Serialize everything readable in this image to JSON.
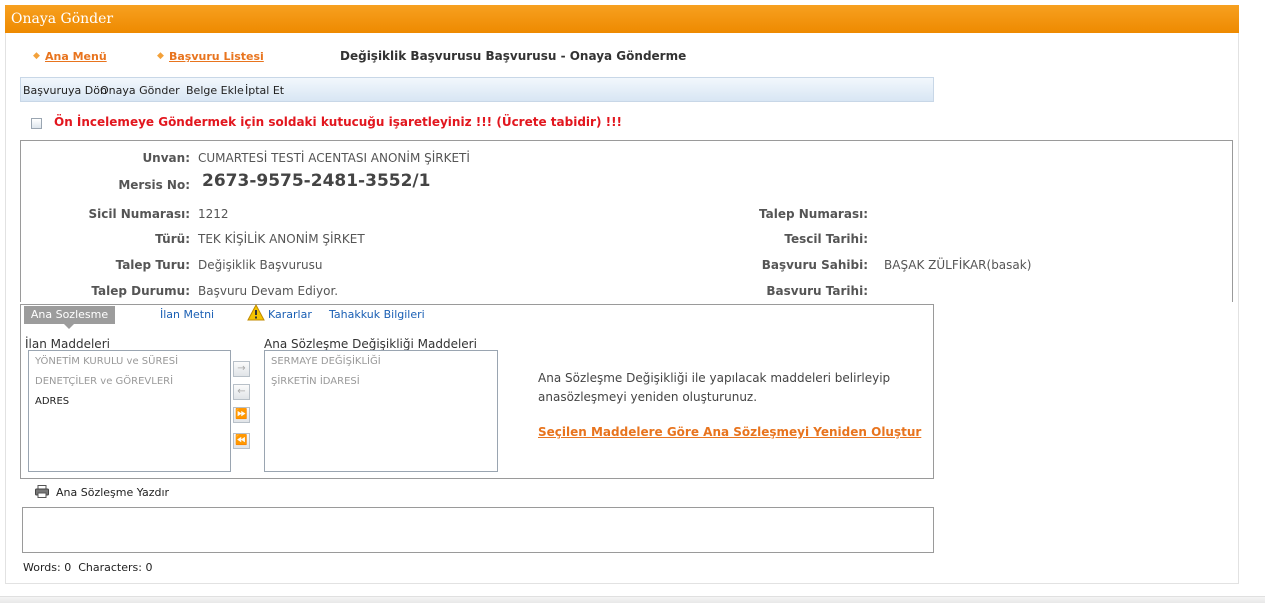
{
  "window": {
    "title": "Onaya Gönder"
  },
  "nav": {
    "main_menu": "Ana Menü",
    "application_list": "Başvuru Listesi",
    "page_title": "Değişiklik Başvurusu Başvurusu - Onaya Gönderme"
  },
  "toolbar": {
    "back": "Başvuruya Dön",
    "send_approval": "Onaya Gönder",
    "add_document": "Belge Ekle",
    "cancel": "İptal Et"
  },
  "warning": {
    "text": "Ön İncelemeye Göndermek için soldaki kutucuğu işaretleyiniz !!! (Ücrete tabidir) !!!"
  },
  "info": {
    "title_label": "Unvan:",
    "title_value": "CUMARTESİ TESTİ ACENTASI ANONİM ŞİRKETİ",
    "mersis_label": "Mersis No:",
    "mersis_value": "2673-9575-2481-3552/1",
    "registry_label": "Sicil Numarası:",
    "registry_value": "1212",
    "type_label": "Türü:",
    "type_value": "TEK KİŞİLİK ANONİM ŞİRKET",
    "request_type_label": "Talep Turu:",
    "request_type_value": "Değişiklik Başvurusu",
    "request_status_label": "Talep Durumu:",
    "request_status_value": "Başvuru Devam Ediyor.",
    "request_no_label": "Talep Numarası:",
    "registration_date_label": "Tescil Tarihi:",
    "applicant_label": "Başvuru Sahibi:",
    "applicant_value": "BAŞAK ZÜLFİKAR(basak)",
    "application_date_label": "Basvuru Tarihi:"
  },
  "tabs": {
    "articles": "Ana Sozlesme",
    "announcement": "İlan Metni",
    "decisions": "Kararlar",
    "accrual": "Tahakkuk Bilgileri"
  },
  "lists": {
    "left_label": "İlan Maddeleri",
    "left_items": [
      {
        "text": "YÖNETİM KURULU ve SÜRESİ",
        "state": "disabled"
      },
      {
        "text": "DENETÇİLER ve GÖREVLERİ",
        "state": "disabled"
      },
      {
        "text": "ADRES",
        "state": "enabled"
      }
    ],
    "right_label": "Ana Sözleşme Değişikliği Maddeleri",
    "right_items": [
      {
        "text": "SERMAYE DEĞİŞİKLİĞİ",
        "state": "disabled"
      },
      {
        "text": "ŞİRKETİN İDARESİ",
        "state": "disabled"
      }
    ],
    "move_buttons": {
      "add_one": "→",
      "remove_one": "←",
      "add_all": "⏩",
      "remove_all": "⏪"
    }
  },
  "hint": {
    "text": "Ana Sözleşme Değişikliği ile yapılacak maddeleri belirleyip anasözleşmeyi yeniden oluşturunuz.",
    "link": "Seçilen Maddelere Göre Ana Sözleşmeyi Yeniden Oluştur"
  },
  "print": {
    "label": "Ana Sözleşme Yazdır"
  },
  "editor": {
    "words_label": "Words:",
    "words": "0",
    "chars_label": "Characters:",
    "chars": "0"
  },
  "colors": {
    "header": "#ee8a00",
    "link": "#e8741e",
    "warning": "#e2161e",
    "tab_link": "#1a5fb4"
  },
  "icons": {
    "nav_arrow": "diamond-arrow-icon",
    "checkbox": "checkbox-icon",
    "decisions": "warning-icon",
    "print": "printer-icon"
  }
}
